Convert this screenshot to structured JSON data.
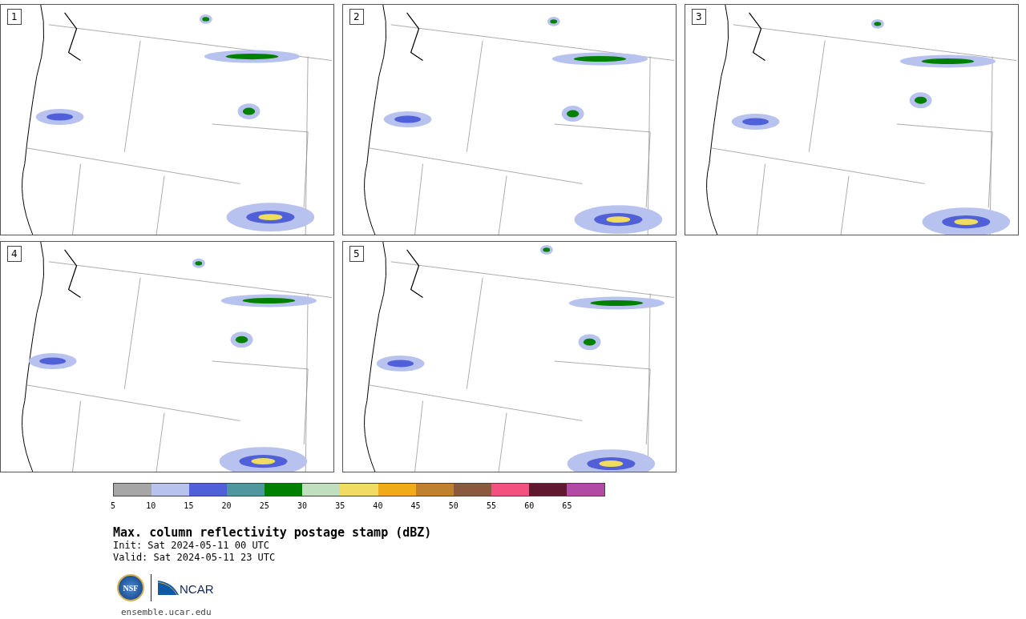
{
  "panels": [
    {
      "label": "1"
    },
    {
      "label": "2"
    },
    {
      "label": "3"
    },
    {
      "label": "4"
    },
    {
      "label": "5"
    }
  ],
  "colorbar": {
    "segments": [
      {
        "color": "#a6a6a6"
      },
      {
        "color": "#b8c2ee"
      },
      {
        "color": "#5060d8"
      },
      {
        "color": "#4f979e"
      },
      {
        "color": "#008000"
      },
      {
        "color": "#bfdfbf"
      },
      {
        "color": "#f0dc60"
      },
      {
        "color": "#f0ac18"
      },
      {
        "color": "#bf8030"
      },
      {
        "color": "#8b5a3c"
      },
      {
        "color": "#f45080"
      },
      {
        "color": "#601830"
      },
      {
        "color": "#b04aa4"
      }
    ],
    "ticks": [
      "5",
      "10",
      "15",
      "20",
      "25",
      "30",
      "35",
      "40",
      "45",
      "50",
      "55",
      "60",
      "65"
    ]
  },
  "title": "Max. column reflectivity postage stamp (dBZ)",
  "init": " Init: Sat 2024-05-11 00 UTC",
  "valid": "Valid: Sat 2024-05-11 23 UTC",
  "logo": {
    "left": "NSF",
    "right": "NCAR"
  },
  "url": "ensemble.ucar.edu"
}
